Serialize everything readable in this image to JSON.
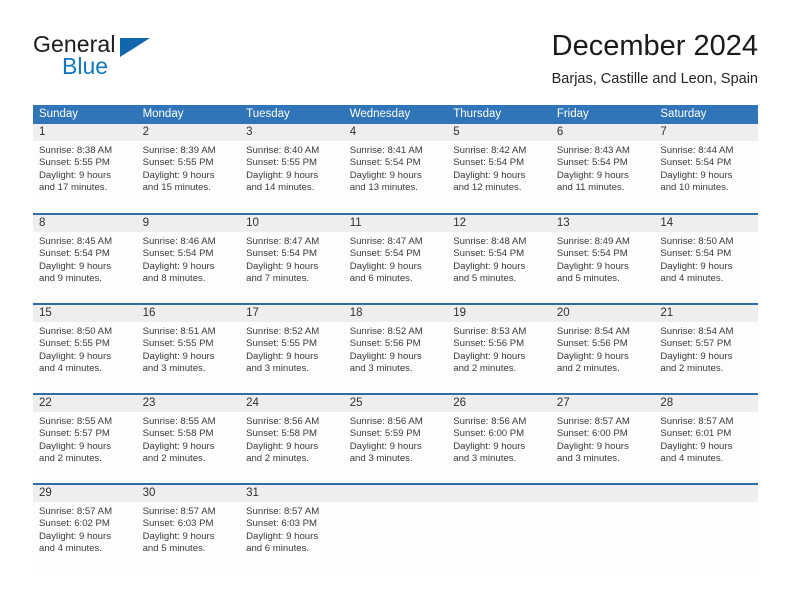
{
  "brand": {
    "line1": "General",
    "line2": "Blue",
    "logo_icon": "triangle-flag-icon"
  },
  "header": {
    "title": "December 2024",
    "subtitle": "Barjas, Castille and Leon, Spain"
  },
  "theme": {
    "header_blue": "#3075b8",
    "row_divider_blue": "#2e6da6",
    "daynum_gray": "#eeeeee",
    "brand_blue": "#1277bd"
  },
  "weekdays": [
    "Sunday",
    "Monday",
    "Tuesday",
    "Wednesday",
    "Thursday",
    "Friday",
    "Saturday"
  ],
  "weeks": [
    [
      {
        "day": "1",
        "sunrise": "Sunrise: 8:38 AM",
        "sunset": "Sunset: 5:55 PM",
        "daylight1": "Daylight: 9 hours",
        "daylight2": "and 17 minutes."
      },
      {
        "day": "2",
        "sunrise": "Sunrise: 8:39 AM",
        "sunset": "Sunset: 5:55 PM",
        "daylight1": "Daylight: 9 hours",
        "daylight2": "and 15 minutes."
      },
      {
        "day": "3",
        "sunrise": "Sunrise: 8:40 AM",
        "sunset": "Sunset: 5:55 PM",
        "daylight1": "Daylight: 9 hours",
        "daylight2": "and 14 minutes."
      },
      {
        "day": "4",
        "sunrise": "Sunrise: 8:41 AM",
        "sunset": "Sunset: 5:54 PM",
        "daylight1": "Daylight: 9 hours",
        "daylight2": "and 13 minutes."
      },
      {
        "day": "5",
        "sunrise": "Sunrise: 8:42 AM",
        "sunset": "Sunset: 5:54 PM",
        "daylight1": "Daylight: 9 hours",
        "daylight2": "and 12 minutes."
      },
      {
        "day": "6",
        "sunrise": "Sunrise: 8:43 AM",
        "sunset": "Sunset: 5:54 PM",
        "daylight1": "Daylight: 9 hours",
        "daylight2": "and 11 minutes."
      },
      {
        "day": "7",
        "sunrise": "Sunrise: 8:44 AM",
        "sunset": "Sunset: 5:54 PM",
        "daylight1": "Daylight: 9 hours",
        "daylight2": "and 10 minutes."
      }
    ],
    [
      {
        "day": "8",
        "sunrise": "Sunrise: 8:45 AM",
        "sunset": "Sunset: 5:54 PM",
        "daylight1": "Daylight: 9 hours",
        "daylight2": "and 9 minutes."
      },
      {
        "day": "9",
        "sunrise": "Sunrise: 8:46 AM",
        "sunset": "Sunset: 5:54 PM",
        "daylight1": "Daylight: 9 hours",
        "daylight2": "and 8 minutes."
      },
      {
        "day": "10",
        "sunrise": "Sunrise: 8:47 AM",
        "sunset": "Sunset: 5:54 PM",
        "daylight1": "Daylight: 9 hours",
        "daylight2": "and 7 minutes."
      },
      {
        "day": "11",
        "sunrise": "Sunrise: 8:47 AM",
        "sunset": "Sunset: 5:54 PM",
        "daylight1": "Daylight: 9 hours",
        "daylight2": "and 6 minutes."
      },
      {
        "day": "12",
        "sunrise": "Sunrise: 8:48 AM",
        "sunset": "Sunset: 5:54 PM",
        "daylight1": "Daylight: 9 hours",
        "daylight2": "and 5 minutes."
      },
      {
        "day": "13",
        "sunrise": "Sunrise: 8:49 AM",
        "sunset": "Sunset: 5:54 PM",
        "daylight1": "Daylight: 9 hours",
        "daylight2": "and 5 minutes."
      },
      {
        "day": "14",
        "sunrise": "Sunrise: 8:50 AM",
        "sunset": "Sunset: 5:54 PM",
        "daylight1": "Daylight: 9 hours",
        "daylight2": "and 4 minutes."
      }
    ],
    [
      {
        "day": "15",
        "sunrise": "Sunrise: 8:50 AM",
        "sunset": "Sunset: 5:55 PM",
        "daylight1": "Daylight: 9 hours",
        "daylight2": "and 4 minutes."
      },
      {
        "day": "16",
        "sunrise": "Sunrise: 8:51 AM",
        "sunset": "Sunset: 5:55 PM",
        "daylight1": "Daylight: 9 hours",
        "daylight2": "and 3 minutes."
      },
      {
        "day": "17",
        "sunrise": "Sunrise: 8:52 AM",
        "sunset": "Sunset: 5:55 PM",
        "daylight1": "Daylight: 9 hours",
        "daylight2": "and 3 minutes."
      },
      {
        "day": "18",
        "sunrise": "Sunrise: 8:52 AM",
        "sunset": "Sunset: 5:56 PM",
        "daylight1": "Daylight: 9 hours",
        "daylight2": "and 3 minutes."
      },
      {
        "day": "19",
        "sunrise": "Sunrise: 8:53 AM",
        "sunset": "Sunset: 5:56 PM",
        "daylight1": "Daylight: 9 hours",
        "daylight2": "and 2 minutes."
      },
      {
        "day": "20",
        "sunrise": "Sunrise: 8:54 AM",
        "sunset": "Sunset: 5:56 PM",
        "daylight1": "Daylight: 9 hours",
        "daylight2": "and 2 minutes."
      },
      {
        "day": "21",
        "sunrise": "Sunrise: 8:54 AM",
        "sunset": "Sunset: 5:57 PM",
        "daylight1": "Daylight: 9 hours",
        "daylight2": "and 2 minutes."
      }
    ],
    [
      {
        "day": "22",
        "sunrise": "Sunrise: 8:55 AM",
        "sunset": "Sunset: 5:57 PM",
        "daylight1": "Daylight: 9 hours",
        "daylight2": "and 2 minutes."
      },
      {
        "day": "23",
        "sunrise": "Sunrise: 8:55 AM",
        "sunset": "Sunset: 5:58 PM",
        "daylight1": "Daylight: 9 hours",
        "daylight2": "and 2 minutes."
      },
      {
        "day": "24",
        "sunrise": "Sunrise: 8:56 AM",
        "sunset": "Sunset: 5:58 PM",
        "daylight1": "Daylight: 9 hours",
        "daylight2": "and 2 minutes."
      },
      {
        "day": "25",
        "sunrise": "Sunrise: 8:56 AM",
        "sunset": "Sunset: 5:59 PM",
        "daylight1": "Daylight: 9 hours",
        "daylight2": "and 3 minutes."
      },
      {
        "day": "26",
        "sunrise": "Sunrise: 8:56 AM",
        "sunset": "Sunset: 6:00 PM",
        "daylight1": "Daylight: 9 hours",
        "daylight2": "and 3 minutes."
      },
      {
        "day": "27",
        "sunrise": "Sunrise: 8:57 AM",
        "sunset": "Sunset: 6:00 PM",
        "daylight1": "Daylight: 9 hours",
        "daylight2": "and 3 minutes."
      },
      {
        "day": "28",
        "sunrise": "Sunrise: 8:57 AM",
        "sunset": "Sunset: 6:01 PM",
        "daylight1": "Daylight: 9 hours",
        "daylight2": "and 4 minutes."
      }
    ],
    [
      {
        "day": "29",
        "sunrise": "Sunrise: 8:57 AM",
        "sunset": "Sunset: 6:02 PM",
        "daylight1": "Daylight: 9 hours",
        "daylight2": "and 4 minutes."
      },
      {
        "day": "30",
        "sunrise": "Sunrise: 8:57 AM",
        "sunset": "Sunset: 6:03 PM",
        "daylight1": "Daylight: 9 hours",
        "daylight2": "and 5 minutes."
      },
      {
        "day": "31",
        "sunrise": "Sunrise: 8:57 AM",
        "sunset": "Sunset: 6:03 PM",
        "daylight1": "Daylight: 9 hours",
        "daylight2": "and 6 minutes."
      },
      {
        "day": "",
        "sunrise": "",
        "sunset": "",
        "daylight1": "",
        "daylight2": ""
      },
      {
        "day": "",
        "sunrise": "",
        "sunset": "",
        "daylight1": "",
        "daylight2": ""
      },
      {
        "day": "",
        "sunrise": "",
        "sunset": "",
        "daylight1": "",
        "daylight2": ""
      },
      {
        "day": "",
        "sunrise": "",
        "sunset": "",
        "daylight1": "",
        "daylight2": ""
      }
    ]
  ]
}
